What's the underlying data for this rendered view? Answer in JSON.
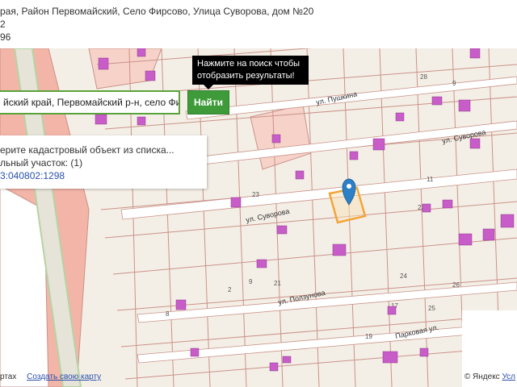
{
  "header": {
    "line1": "рая, Район Первомайский, Село Фирсово, Улица Суворова, дом №20",
    "line2": "2",
    "line3": "96"
  },
  "tooltip": {
    "line1": "Нажмите на поиск чтобы",
    "line2": "отобразить результаты!"
  },
  "search": {
    "value": "йский край, Первомайский р-н, село Фи",
    "button_label": "Найти"
  },
  "panel": {
    "line1": "ерите кадастровый объект из списка...",
    "line2": "льный участок: (1)",
    "link": "3:040802:1298"
  },
  "streets": {
    "pushkina": "ул. Пушкина",
    "suvorova_top": "ул. Суворова",
    "suvorova_mid": "ул. Суворова",
    "polzunova": "ул. Ползунова",
    "parkovaya": "Парковая ул."
  },
  "parcel_numbers": [
    "28",
    "2",
    "24",
    "9",
    "26",
    "22",
    "21",
    "17",
    "25",
    "19",
    "8",
    "9",
    "23",
    "11"
  ],
  "footer": {
    "left_text": "ртах",
    "create_link": "Создать свою карту",
    "copyright": "© Яндекс",
    "terms_link": "Усл"
  },
  "colors": {
    "map_background": "#f4efe6",
    "parcel_border": "#c9928a",
    "building": "#c85cc8",
    "selected_parcel": "#f2a53a",
    "marker": "#2d7fc6",
    "search_border": "#5aa23a",
    "find_button": "#3f9b3a",
    "red_zone": "#f2b5a8"
  }
}
